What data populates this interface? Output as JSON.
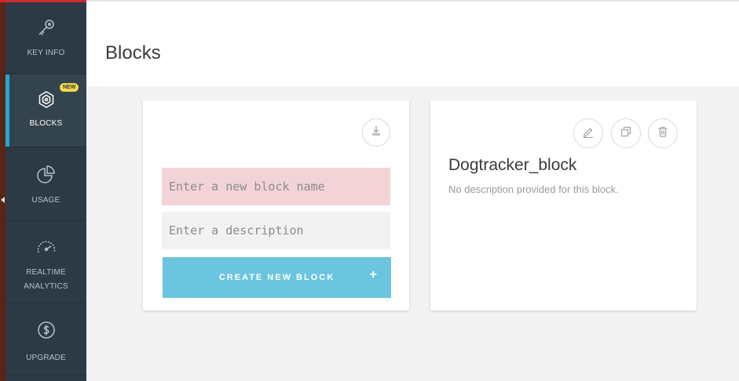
{
  "sidebar": {
    "items": [
      {
        "label": "KEY INFO",
        "icon": "key-icon"
      },
      {
        "label": "BLOCKS",
        "icon": "blocks-icon",
        "badge": "NEW",
        "active": true
      },
      {
        "label": "USAGE",
        "icon": "pie-chart-icon"
      },
      {
        "label": "REALTIME\nANALYTICS",
        "icon": "speedometer-icon"
      },
      {
        "label": "UPGRADE",
        "icon": "dollar-icon"
      }
    ]
  },
  "header": {
    "title": "Blocks"
  },
  "create_card": {
    "name_placeholder": "Enter a new block name",
    "description_placeholder": "Enter a description",
    "create_label": "CREATE NEW BLOCK",
    "create_icon": "+",
    "download_icon": "download-icon"
  },
  "block_card": {
    "name": "Dogtracker_block",
    "description": "No description provided for this block.",
    "actions": [
      "edit-icon",
      "duplicate-icon",
      "delete-icon"
    ]
  },
  "colors": {
    "sidebar_bg": "#2c3a46",
    "accent": "#21a8d5",
    "badge": "#f4dc44",
    "create_button": "#6bc5de",
    "name_field": "#f2d4d8"
  }
}
